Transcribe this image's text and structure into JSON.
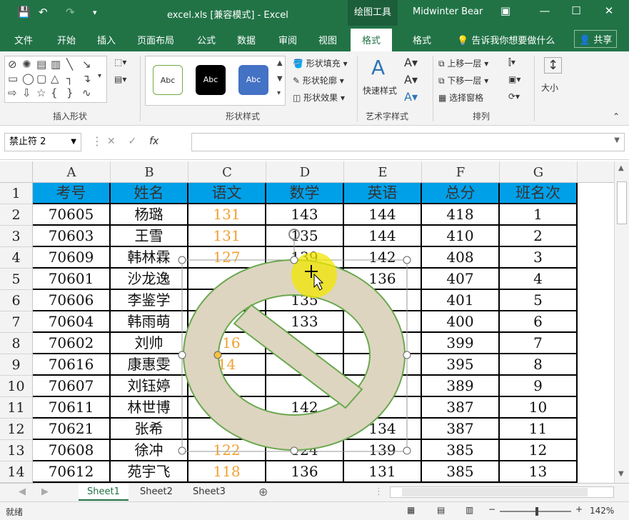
{
  "window": {
    "title": "excel.xls  [兼容模式]  -  Excel",
    "context_tab": "绘图工具",
    "user": "Midwinter Bear"
  },
  "tabs": [
    "文件",
    "开始",
    "插入",
    "页面布局",
    "公式",
    "数据",
    "审阅",
    "视图",
    "格式",
    "格式"
  ],
  "active_tab_index": 8,
  "tell_me": "告诉我你想要做什么",
  "share": "共享",
  "ribbon": {
    "groups": {
      "insert_shapes": "插入形状",
      "shape_styles": "形状样式",
      "wordart_styles": "艺术字样式",
      "arrange": "排列"
    },
    "style_swatches": [
      "Abc",
      "Abc",
      "Abc"
    ],
    "shape_fill": "形状填充",
    "shape_outline": "形状轮廓",
    "shape_effects": "形状效果",
    "quick_styles": "快速样式",
    "bring_forward": "上移一层",
    "send_backward": "下移一层",
    "selection_pane": "选择窗格",
    "size": "大小"
  },
  "formula_bar": {
    "name_box": "禁止符 2",
    "fx": "fx",
    "value": ""
  },
  "columns": [
    "A",
    "B",
    "C",
    "D",
    "E",
    "F",
    "G"
  ],
  "rows": [
    "1",
    "2",
    "3",
    "4",
    "5",
    "6",
    "7",
    "8",
    "9",
    "10",
    "11",
    "12",
    "13",
    "14"
  ],
  "table": {
    "header": [
      "考号",
      "姓名",
      "语文",
      "数学",
      "英语",
      "总分",
      "班名次"
    ],
    "rows": [
      [
        "70605",
        "杨璐",
        "131",
        "143",
        "144",
        "418",
        "1"
      ],
      [
        "70603",
        "王雪",
        "131",
        "135",
        "144",
        "410",
        "2"
      ],
      [
        "70609",
        "韩林霖",
        "127",
        "139",
        "142",
        "408",
        "3"
      ],
      [
        "70601",
        "沙龙逸",
        "",
        "",
        "136",
        "407",
        "4"
      ],
      [
        "70606",
        "李鉴学",
        "",
        "135",
        "",
        "401",
        "5"
      ],
      [
        "70604",
        "韩雨萌",
        "",
        "133",
        "",
        "400",
        "6"
      ],
      [
        "70602",
        "刘帅",
        "116",
        "",
        "",
        "399",
        "7"
      ],
      [
        "70616",
        "康惠雯",
        "14",
        "",
        "",
        "395",
        "8"
      ],
      [
        "70607",
        "刘钰婷",
        "",
        "",
        "",
        "389",
        "9"
      ],
      [
        "70611",
        "林世博",
        "",
        "142",
        "",
        "387",
        "10"
      ],
      [
        "70621",
        "张希",
        "",
        "",
        "134",
        "387",
        "11"
      ],
      [
        "70608",
        "徐冲",
        "122",
        "124",
        "139",
        "385",
        "12"
      ],
      [
        "70612",
        "苑宇飞",
        "118",
        "136",
        "131",
        "385",
        "13"
      ]
    ]
  },
  "sheets": [
    "Sheet1",
    "Sheet2",
    "Sheet3"
  ],
  "active_sheet": "Sheet1",
  "status": {
    "ready": "就绪",
    "zoom": "142%"
  },
  "colors": {
    "excel_green": "#217346",
    "header_fill": "#00a0e9",
    "score_orange": "#f0a030",
    "shape_fill": "#ddd5c0",
    "shape_outline": "#6aa84f"
  }
}
